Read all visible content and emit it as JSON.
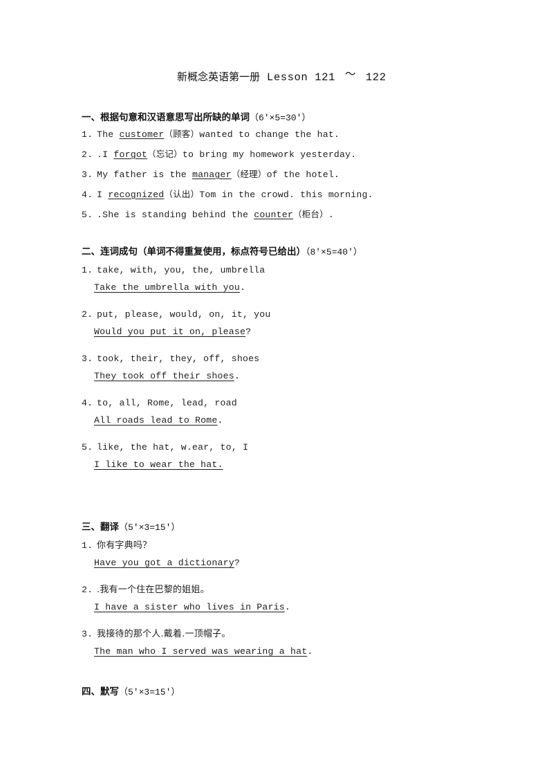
{
  "document": {
    "title_cjk": "新概念英语第一册",
    "title_lesson": "Lesson",
    "title_from": "121",
    "title_tilde": "～",
    "title_to": "122"
  },
  "sections": [
    {
      "heading": "一、根据句意和汉语意思写出所缺的单词",
      "points": "（6'×5=30'）",
      "items": [
        {
          "number": "1.",
          "before": "The",
          "blank": "customer",
          "hint": "（顾客）",
          "after": "wanted to change the hat."
        },
        {
          "number": "2.",
          "before": ".I",
          "blank": "forgot",
          "hint": "（忘记）",
          "after": "to bring my homework yesterday."
        },
        {
          "number": "3.",
          "before": "My father is the",
          "blank": "manager",
          "hint": "（经理）",
          "after": "of the hotel."
        },
        {
          "number": "4.",
          "before": "I",
          "blank": "recognized",
          "hint": "（认出）",
          "after": "Tom in the crowd. this morning."
        },
        {
          "number": "5.",
          "before": ".She is standing behind the",
          "blank": "counter",
          "hint": "（柜台）",
          "after": "."
        }
      ]
    },
    {
      "heading": "二、连词成句（单词不得重复使用，标点符号已给出）",
      "points": "（8'×5=40'）",
      "items": [
        {
          "number": "1.",
          "prompt": "take, with, you, the, umbrella",
          "answer": "Take the umbrella with you",
          "trailing": "."
        },
        {
          "number": "2.",
          "prompt": "put, please, would, on, it, you",
          "answer": "Would you put it on, please",
          "trailing": "?"
        },
        {
          "number": "3.",
          "prompt": "took, their, they, off, shoes",
          "answer": "They took off their shoes",
          "trailing": "."
        },
        {
          "number": "4.",
          "prompt": "to, all, Rome, lead, road",
          "answer": "All roads lead to Rome",
          "trailing": "."
        },
        {
          "number": "5.",
          "prompt": "like, the hat, w.ear, to, I",
          "answer": "I like to wear the hat. ",
          "trailing": ""
        }
      ]
    },
    {
      "heading": "三、翻译",
      "points": "（5'×3=15'）",
      "items": [
        {
          "number": "1.",
          "prompt": "你有字典吗？",
          "answer": "Have you got a dictionary",
          "trailing": "?"
        },
        {
          "number": "2.",
          "prompt": ".我有一个住在巴黎的姐姐。",
          "answer": "I have a sister who lives in Paris",
          "trailing": "."
        },
        {
          "number": "3.",
          "prompt": "我接待的那个人.戴着.一顶帽子。",
          "answer": "The man who I served was wearing a hat",
          "trailing": "."
        }
      ]
    },
    {
      "heading": "四、默写",
      "points": "（5'×3=15'）",
      "items": []
    }
  ]
}
